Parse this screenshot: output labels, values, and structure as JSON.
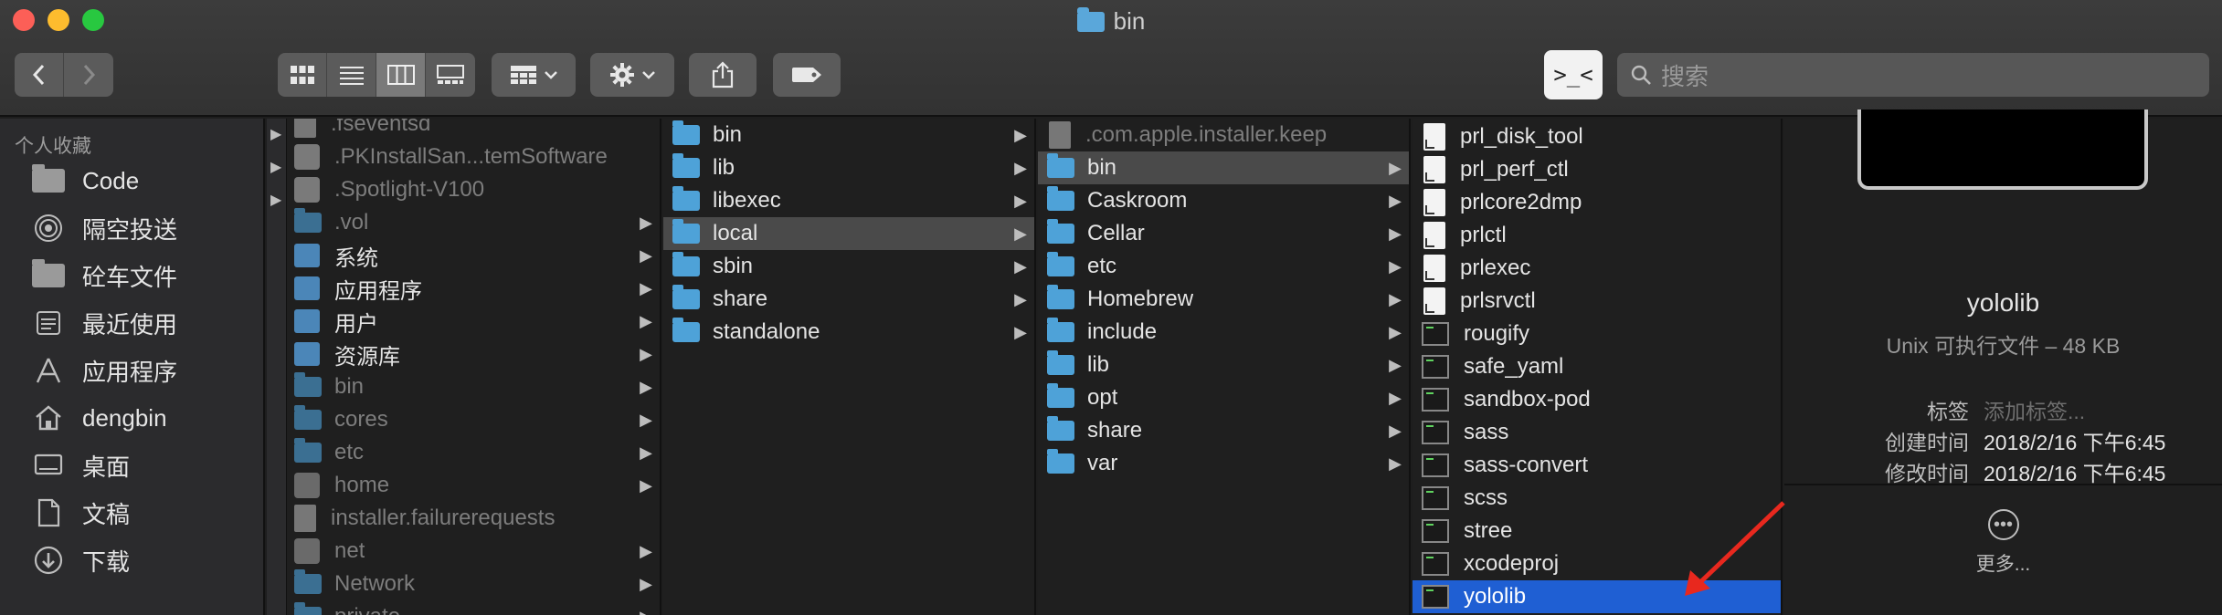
{
  "window": {
    "title": "bin"
  },
  "toolbar": {
    "back_icon": "chevron-left-icon",
    "forward_icon": "chevron-right-icon",
    "view_modes": [
      "icon-view-icon",
      "list-view-icon",
      "column-view-icon",
      "gallery-view-icon"
    ],
    "group_icon": "group-by-icon",
    "action_icon": "gear-icon",
    "share_icon": "share-icon",
    "tag_icon": "tag-icon",
    "terminal_label": ">_<",
    "search_placeholder": "搜索"
  },
  "sidebar": {
    "section": "个人收藏",
    "items": [
      {
        "label": "Code",
        "icon": "folder-icon"
      },
      {
        "label": "隔空投送",
        "icon": "airdrop-icon"
      },
      {
        "label": "砼车文件",
        "icon": "folder-icon"
      },
      {
        "label": "最近使用",
        "icon": "recents-icon"
      },
      {
        "label": "应用程序",
        "icon": "applications-icon"
      },
      {
        "label": "dengbin",
        "icon": "home-icon"
      },
      {
        "label": "桌面",
        "icon": "desktop-icon"
      },
      {
        "label": "文稿",
        "icon": "documents-icon"
      },
      {
        "label": "下载",
        "icon": "downloads-icon"
      }
    ]
  },
  "columns": {
    "col1": [
      {
        "name": ".fseventsd",
        "dim": true
      },
      {
        "name": ".PKInstallSan...temSoftware",
        "dim": true
      },
      {
        "name": ".Spotlight-V100",
        "dim": true
      },
      {
        "name": ".vol",
        "dim": true,
        "arrow": "▶"
      },
      {
        "name": "系统",
        "arrow": "▶"
      },
      {
        "name": "应用程序",
        "arrow": "▶"
      },
      {
        "name": "用户",
        "arrow": "▶"
      },
      {
        "name": "资源库",
        "arrow": "▶"
      },
      {
        "name": "bin",
        "dim": true,
        "arrow": "▶"
      },
      {
        "name": "cores",
        "dim": true,
        "arrow": "▶"
      },
      {
        "name": "etc",
        "dim": true,
        "arrow": "▶"
      },
      {
        "name": "home",
        "dim": true,
        "arrow": "▶"
      },
      {
        "name": "installer.failurerequests",
        "dim": true
      },
      {
        "name": "net",
        "dim": true,
        "arrow": "▶"
      },
      {
        "name": "Network",
        "dim": true,
        "arrow": "▶"
      },
      {
        "name": "private",
        "dim": true,
        "arrow": "▶"
      }
    ],
    "col2": [
      {
        "name": "bin",
        "arrow": "▶"
      },
      {
        "name": "lib",
        "arrow": "▶"
      },
      {
        "name": "libexec",
        "arrow": "▶"
      },
      {
        "name": "local",
        "arrow": "▶",
        "selected": true
      },
      {
        "name": "sbin",
        "arrow": "▶"
      },
      {
        "name": "share",
        "arrow": "▶"
      },
      {
        "name": "standalone",
        "arrow": "▶"
      }
    ],
    "col3": [
      {
        "name": ".com.apple.installer.keep",
        "dim": true
      },
      {
        "name": "bin",
        "arrow": "▶",
        "selected": true
      },
      {
        "name": "Caskroom",
        "arrow": "▶"
      },
      {
        "name": "Cellar",
        "arrow": "▶"
      },
      {
        "name": "etc",
        "arrow": "▶"
      },
      {
        "name": "Homebrew",
        "arrow": "▶"
      },
      {
        "name": "include",
        "arrow": "▶"
      },
      {
        "name": "lib",
        "arrow": "▶"
      },
      {
        "name": "opt",
        "arrow": "▶"
      },
      {
        "name": "share",
        "arrow": "▶"
      },
      {
        "name": "var",
        "arrow": "▶"
      }
    ],
    "col4": [
      {
        "name": "prl_disk_tool",
        "kind": "alias"
      },
      {
        "name": "prl_perf_ctl",
        "kind": "alias"
      },
      {
        "name": "prlcore2dmp",
        "kind": "alias"
      },
      {
        "name": "prlctl",
        "kind": "alias"
      },
      {
        "name": "prlexec",
        "kind": "alias"
      },
      {
        "name": "prlsrvctl",
        "kind": "alias"
      },
      {
        "name": "rougify",
        "kind": "exec"
      },
      {
        "name": "safe_yaml",
        "kind": "exec"
      },
      {
        "name": "sandbox-pod",
        "kind": "exec"
      },
      {
        "name": "sass",
        "kind": "exec"
      },
      {
        "name": "sass-convert",
        "kind": "exec"
      },
      {
        "name": "scss",
        "kind": "exec"
      },
      {
        "name": "stree",
        "kind": "exec"
      },
      {
        "name": "xcodeproj",
        "kind": "exec"
      },
      {
        "name": "yololib",
        "kind": "exec",
        "highlighted": true
      }
    ]
  },
  "preview": {
    "name": "yololib",
    "kind": "Unix 可执行文件 – 48 KB",
    "tags_label": "标签",
    "tags_placeholder": "添加标签...",
    "created_label": "创建时间",
    "created_value": "2018/2/16 下午6:45",
    "modified_label": "修改时间",
    "modified_value": "2018/2/16 下午6:45",
    "more_label": "更多..."
  },
  "colors": {
    "accent": "#1f5fd3",
    "folder": "#4ea2d8",
    "annotation_arrow": "#e8281e"
  }
}
